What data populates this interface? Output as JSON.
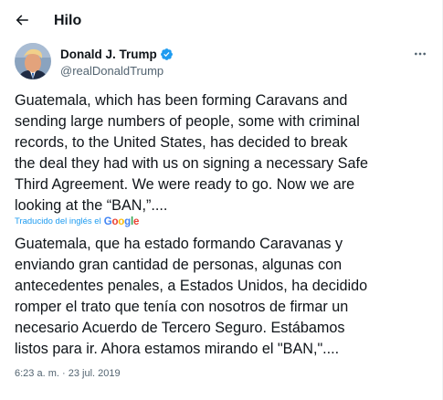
{
  "header": {
    "back_label": "Back",
    "title": "Hilo"
  },
  "author": {
    "name": "Donald J. Trump",
    "handle": "@realDonaldTrump",
    "verified": true
  },
  "tweet": {
    "lines": [
      "Guatemala, which has been forming Caravans and",
      "sending large numbers of people, some with criminal",
      "records, to the United States, has decided to break",
      "the deal they had with us on signing a necessary Safe",
      "Third Agreement. We were ready to go. Now we are",
      "looking at the “BAN,”...."
    ],
    "translated_label": "Traducido del inglés el",
    "translation_provider": "Google",
    "translation_lines": [
      "Guatemala, que ha estado formando Caravanas y",
      "enviando gran cantidad de personas, algunas con",
      "antecedentes penales, a Estados Unidos, ha decidido",
      "romper el trato que tenía con nosotros de firmar un",
      "necesario Acuerdo de Tercero Seguro. Estábamos",
      "listos para ir. Ahora estamos mirando el \"BAN,\"...."
    ],
    "time": "6:23 a. m.",
    "separator": "·",
    "date": "23 jul. 2019"
  },
  "icons": {
    "back": "arrow-left-icon",
    "verified": "verified-badge-icon",
    "more": "more-horizontal-icon"
  },
  "colors": {
    "accent": "#1d9bf0",
    "text": "#0f1419",
    "secondary": "#536471"
  }
}
